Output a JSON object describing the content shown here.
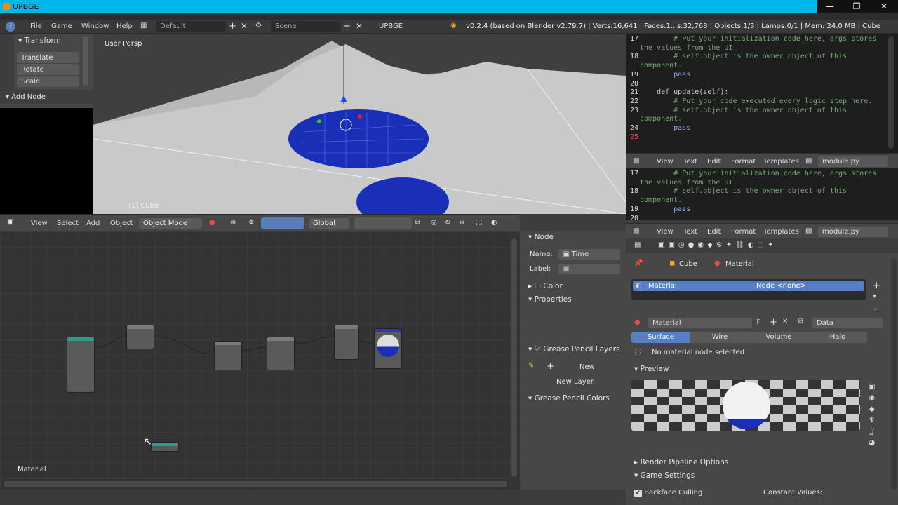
{
  "window": {
    "title": "UPBGE",
    "min": "—",
    "restore": "❐",
    "close": "✕"
  },
  "menu": {
    "items": [
      "File",
      "Game",
      "Window",
      "Help"
    ],
    "layout": "Default",
    "scene": "Scene",
    "engine": "UPBGE",
    "info": "v0.2.4 (based on Blender v2.79.7) | Verts:16,641 | Faces:1..is:32,768 | Objects:1/3 | Lamps:0/1 | Mem: 24.0 MB | Cube"
  },
  "tools": {
    "transform_header": "Transform",
    "translate": "Translate",
    "rotate": "Rotate",
    "scale": "Scale",
    "add_node_header": "Add Node"
  },
  "viewport": {
    "label": "User Persp",
    "object": "(1) Cube"
  },
  "view3d_toolbar": {
    "view": "View",
    "select": "Select",
    "add": "Add",
    "object": "Object",
    "mode": "Object Mode",
    "orientation": "Global"
  },
  "code_top": {
    "lines": [
      {
        "n": "17",
        "t": "        # Put your initialization code here, args stores",
        "cls": "c-cm"
      },
      {
        "n": "",
        "t": "the values from the UI.",
        "cls": "c-cm"
      },
      {
        "n": "18",
        "t": "        # self.object is the owner object of this",
        "cls": "c-cm"
      },
      {
        "n": "",
        "t": "component.",
        "cls": "c-cm"
      },
      {
        "n": "19",
        "t": "        pass",
        "cls": "c-kw"
      },
      {
        "n": "20",
        "t": "",
        "cls": ""
      },
      {
        "n": "21",
        "t": "    def update(self):",
        "cls": ""
      },
      {
        "n": "22",
        "t": "        # Put your code executed every logic step here.",
        "cls": "c-cm"
      },
      {
        "n": "23",
        "t": "        # self.object is the owner object of this",
        "cls": "c-cm"
      },
      {
        "n": "",
        "t": "component.",
        "cls": "c-cm"
      },
      {
        "n": "24",
        "t": "        pass",
        "cls": "c-kw"
      },
      {
        "n": "25",
        "t": "",
        "cls": ""
      }
    ]
  },
  "text_header": {
    "view": "View",
    "text": "Text",
    "edit": "Edit",
    "format": "Format",
    "templates": "Templates",
    "file": "module.py"
  },
  "code_bottom": {
    "lines": [
      {
        "n": "17",
        "t": "        # Put your initialization code here, args stores",
        "cls": "c-cm"
      },
      {
        "n": "",
        "t": "the values from the UI.",
        "cls": "c-cm"
      },
      {
        "n": "18",
        "t": "        # self.object is the owner object of this",
        "cls": "c-cm"
      },
      {
        "n": "",
        "t": "component.",
        "cls": "c-cm"
      },
      {
        "n": "19",
        "t": "        pass",
        "cls": "c-kw"
      },
      {
        "n": "20",
        "t": "",
        "cls": ""
      }
    ]
  },
  "node_editor": {
    "label": "Material"
  },
  "node_panel": {
    "node_header": "Node",
    "name_label": "Name:",
    "name_value": "Time",
    "label_label": "Label:",
    "color": "Color",
    "properties": "Properties",
    "gp_layers": "Grease Pencil Layers",
    "new": "New",
    "new_layer": "New Layer",
    "gp_colors": "Grease Pencil Colors"
  },
  "properties": {
    "breadcrumb_obj": "Cube",
    "breadcrumb_mat": "Material",
    "slot_name": "Material",
    "slot_node": "Node <none>",
    "datablock": "Material",
    "f": "F",
    "data": "Data",
    "tabs": [
      "Surface",
      "Wire",
      "Volume",
      "Halo"
    ],
    "no_node": "No material node selected",
    "preview": "Preview",
    "render_pipeline": "Render Pipeline Options",
    "game_settings": "Game Settings",
    "backface": "Backface Culling",
    "constant": "Constant Values:"
  }
}
